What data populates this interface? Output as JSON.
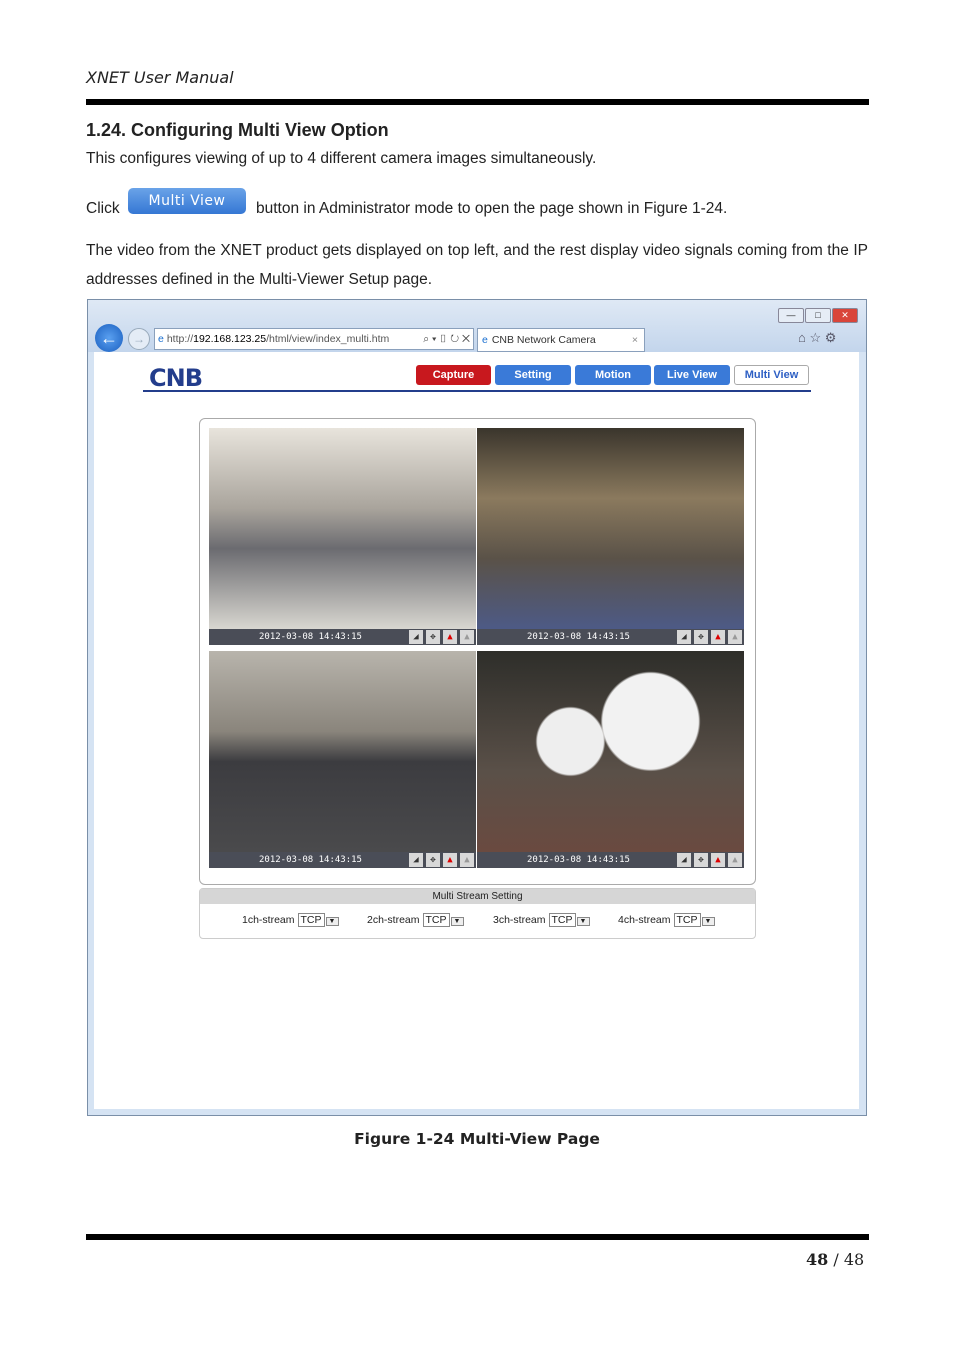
{
  "header": {
    "manual_title": "XNET User Manual"
  },
  "section": {
    "title": "1.24. Configuring Multi View Option",
    "intro": "This configures viewing of up to 4 different camera images simultaneously.",
    "click_prefix": "Click",
    "button_label": "Multi View",
    "click_suffix": "button in Administrator mode to open the page shown in Figure 1-24.",
    "paragraph": "The video from the XNET product gets displayed on top left, and the rest display video signals coming from the IP addresses defined in the Multi-Viewer Setup page."
  },
  "figure": {
    "browser": {
      "url_prefix": "http://",
      "url_host": "192.168.123.25",
      "url_path": "/html/view/index_multi.htm",
      "tab_title": "CNB Network Camera"
    },
    "logo": "CNB",
    "nav": [
      "Capture",
      "Setting",
      "Motion",
      "Live View",
      "Multi View"
    ],
    "nav_colors": {
      "capture": "#c8181e",
      "normal": "#3a7ad8",
      "active": "#ffffff"
    },
    "tiles": [
      {
        "timestamp": "2012-03-08 14:43:15"
      },
      {
        "timestamp": "2012-03-08 14:43:15"
      },
      {
        "timestamp": "2012-03-08 14:43:15"
      },
      {
        "timestamp": "2012-03-08 14:43:15"
      }
    ],
    "stream_setting": {
      "title": "Multi Stream Setting",
      "streams": [
        {
          "label": "1ch-stream",
          "value": "TCP"
        },
        {
          "label": "2ch-stream",
          "value": "TCP"
        },
        {
          "label": "3ch-stream",
          "value": "TCP"
        },
        {
          "label": "4ch-stream",
          "value": "TCP"
        }
      ]
    },
    "caption": "Figure 1-24 Multi-View Page"
  },
  "footer": {
    "page": "48",
    "separator": "/",
    "total": "48"
  }
}
